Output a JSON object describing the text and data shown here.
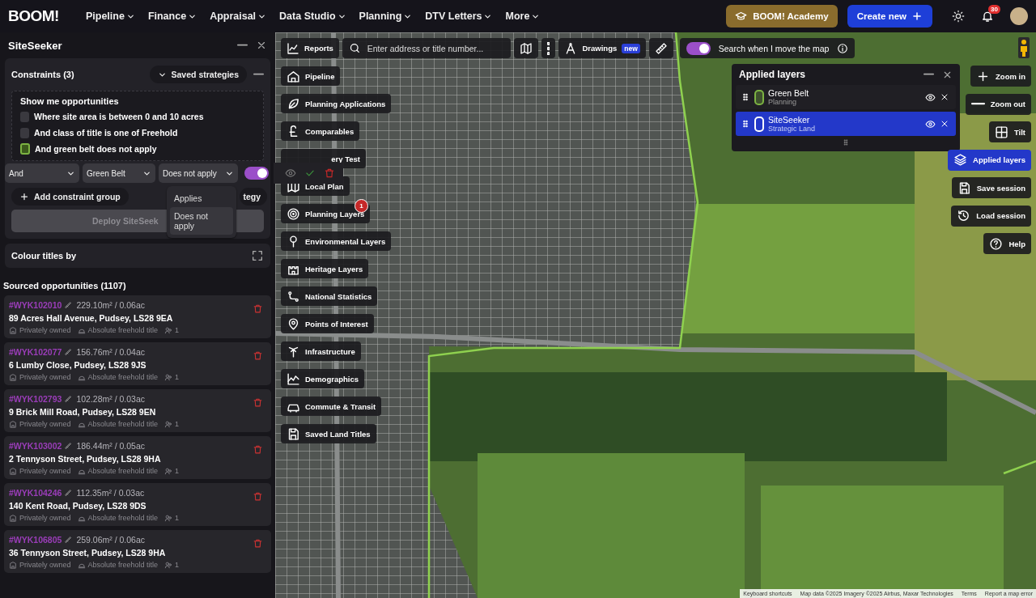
{
  "nav": {
    "logo": "BOOM!",
    "items": [
      {
        "label": "Pipeline"
      },
      {
        "label": "Finance"
      },
      {
        "label": "Appraisal"
      },
      {
        "label": "Data Studio"
      },
      {
        "label": "Planning"
      },
      {
        "label": "DTV Letters"
      },
      {
        "label": "More"
      }
    ],
    "academy": "BOOM! Academy",
    "create": "Create new",
    "notifications": "30"
  },
  "panel": {
    "title": "SiteSeeker",
    "constraints": {
      "title": "Constraints (3)",
      "saved": "Saved strategies",
      "heading": "Show me opportunities",
      "rules": [
        {
          "label": "Where site area is between 0 and 10 acres",
          "checked": false
        },
        {
          "label": "And class of title is one of Freehold",
          "checked": false
        },
        {
          "label": "And green belt does not apply",
          "checked": true
        }
      ],
      "selects": [
        {
          "value": "And"
        },
        {
          "value": "Green Belt"
        },
        {
          "value": "Does not apply"
        }
      ],
      "toggle": {
        "on": true
      },
      "add_group": "Add constraint group",
      "strategy_button": "tegy",
      "deploy": {
        "label": "Deploy SiteSeek",
        "disabled": true
      },
      "menu": [
        {
          "label": "Applies",
          "selected": false
        },
        {
          "label": "Does not apply",
          "selected": true
        }
      ]
    },
    "colour_titles": "Colour titles by",
    "opportunities": {
      "title": "Sourced opportunities (1107)",
      "items": [
        {
          "ref": "#WYK102010",
          "area": "229.10m² / 0.06ac",
          "address": "89 Acres Hall Avenue, Pudsey, LS28 9EA",
          "ownership": "Privately owned",
          "tenure": "Absolute freehold title",
          "count": "1"
        },
        {
          "ref": "#WYK102077",
          "area": "156.76m² / 0.04ac",
          "address": "6 Lumby Close, Pudsey, LS28 9JS",
          "ownership": "Privately owned",
          "tenure": "Absolute freehold title",
          "count": "1"
        },
        {
          "ref": "#WYK102793",
          "area": "102.28m² / 0.03ac",
          "address": "9 Brick Mill Road, Pudsey, LS28 9EN",
          "ownership": "Privately owned",
          "tenure": "Absolute freehold title",
          "count": "1"
        },
        {
          "ref": "#WYK103002",
          "area": "186.44m² / 0.05ac",
          "address": "2 Tennyson Street, Pudsey, LS28 9HA",
          "ownership": "Privately owned",
          "tenure": "Absolute freehold title",
          "count": "1"
        },
        {
          "ref": "#WYK104246",
          "area": "112.35m² / 0.03ac",
          "address": "140 Kent Road, Pudsey, LS28 9DS",
          "ownership": "Privately owned",
          "tenure": "Absolute freehold title",
          "count": "1"
        },
        {
          "ref": "#WYK106805",
          "area": "259.06m² / 0.06ac",
          "address": "36 Tennyson Street, Pudsey, LS28 9HA",
          "ownership": "Privately owned",
          "tenure": "Absolute freehold title",
          "count": "1"
        }
      ]
    }
  },
  "map": {
    "toolbar": {
      "reports": "Reports",
      "search_placeholder": "Enter address or title number...",
      "drawings": "Drawings",
      "drawings_badge": "new",
      "search_on_move": {
        "label": "Search when I move the map",
        "on": true
      }
    },
    "layers": [
      {
        "label": "Pipeline"
      },
      {
        "label": "Planning Applications"
      },
      {
        "label": "Comparables"
      },
      {
        "label": "ery Test"
      },
      {
        "label": "Local Plan"
      },
      {
        "label": "Planning Layers"
      },
      {
        "label": "Environmental Layers"
      },
      {
        "label": "Heritage Layers"
      },
      {
        "label": "National Statistics"
      },
      {
        "label": "Points of Interest"
      },
      {
        "label": "Infrastructure"
      },
      {
        "label": "Demographics"
      },
      {
        "label": "Commute & Transit"
      },
      {
        "label": "Saved Land Titles"
      }
    ],
    "applied_layers": {
      "title": "Applied layers",
      "items": [
        {
          "name": "Green Belt",
          "category": "Planning",
          "color": "#7cb342",
          "selected": false
        },
        {
          "name": "SiteSeeker",
          "category": "Strategic Land",
          "color": "#ffffff",
          "selected": true
        }
      ]
    },
    "controls": [
      {
        "label": "Zoom in",
        "selected": false
      },
      {
        "label": "Zoom out",
        "selected": false
      },
      {
        "label": "Tilt",
        "selected": false
      },
      {
        "label": "Applied layers",
        "selected": true
      },
      {
        "label": "Save session",
        "selected": false
      },
      {
        "label": "Load session",
        "selected": false
      },
      {
        "label": "Help",
        "selected": false
      }
    ],
    "marker": "1",
    "footer": [
      "Keyboard shortcuts",
      "Map data ©2025 Imagery ©2025 Airbus, Maxar Technologies",
      "Terms",
      "Report a map error"
    ]
  }
}
